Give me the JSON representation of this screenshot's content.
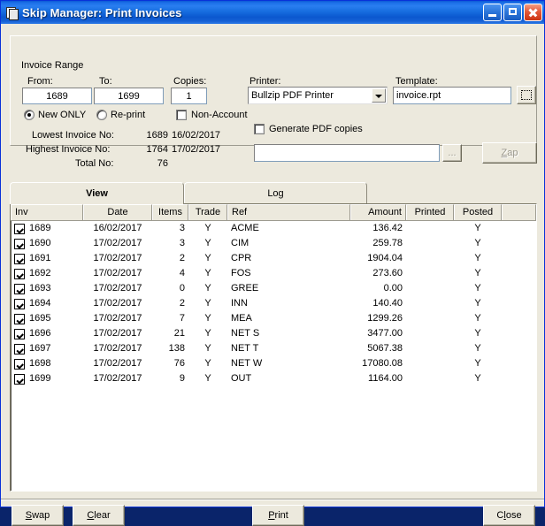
{
  "window": {
    "title": "Skip Manager: Print Invoices",
    "icon": "invoices-icon",
    "minimize_label": "Minimize",
    "maximize_label": "Maximize",
    "close_label": "Close"
  },
  "invoice_range": {
    "legend": "Invoice Range",
    "from_label": "From:",
    "from_value": "1689",
    "to_label": "To:",
    "to_value": "1699",
    "copies_label": "Copies:",
    "copies_value": "1",
    "new_only_label": "New ONLY",
    "new_only_checked": true,
    "reprint_label": "Re-print",
    "reprint_checked": false,
    "non_account_label": "Non-Account",
    "non_account_checked": false,
    "lowest_label": "Lowest Invoice No:",
    "lowest_no": "1689",
    "lowest_date": "16/02/2017",
    "highest_label": "Highest Invoice No:",
    "highest_no": "1764",
    "highest_date": "17/02/2017",
    "total_label": "Total No:",
    "total_value": "76"
  },
  "printer": {
    "printer_label": "Printer:",
    "printer_value": "Bullzip PDF Printer",
    "template_label": "Template:",
    "template_value": "invoice.rpt",
    "template_browse": "…",
    "generate_pdf_label": "Generate PDF copies",
    "generate_pdf_checked": false,
    "pdf_path_value": "",
    "pdf_browse_label": "...",
    "zap_label": "Zap",
    "zap_disabled": true
  },
  "tabs": [
    {
      "label": "View",
      "active": true
    },
    {
      "label": "Log",
      "active": false
    }
  ],
  "table": {
    "columns": [
      "Inv",
      "Date",
      "Items",
      "Trade",
      "Ref",
      "Amount",
      "Printed",
      "Posted",
      ""
    ],
    "rows": [
      {
        "checked": true,
        "inv": "1689",
        "date": "16/02/2017",
        "items": "3",
        "trade": "Y",
        "ref": "ACME",
        "amount": "136.42",
        "printed": "",
        "posted": "Y"
      },
      {
        "checked": true,
        "inv": "1690",
        "date": "17/02/2017",
        "items": "3",
        "trade": "Y",
        "ref": "CIM",
        "amount": "259.78",
        "printed": "",
        "posted": "Y"
      },
      {
        "checked": true,
        "inv": "1691",
        "date": "17/02/2017",
        "items": "2",
        "trade": "Y",
        "ref": "CPR",
        "amount": "1904.04",
        "printed": "",
        "posted": "Y"
      },
      {
        "checked": true,
        "inv": "1692",
        "date": "17/02/2017",
        "items": "4",
        "trade": "Y",
        "ref": "FOS",
        "amount": "273.60",
        "printed": "",
        "posted": "Y"
      },
      {
        "checked": true,
        "inv": "1693",
        "date": "17/02/2017",
        "items": "0",
        "trade": "Y",
        "ref": "GREE",
        "amount": "0.00",
        "printed": "",
        "posted": "Y"
      },
      {
        "checked": true,
        "inv": "1694",
        "date": "17/02/2017",
        "items": "2",
        "trade": "Y",
        "ref": "INN",
        "amount": "140.40",
        "printed": "",
        "posted": "Y"
      },
      {
        "checked": true,
        "inv": "1695",
        "date": "17/02/2017",
        "items": "7",
        "trade": "Y",
        "ref": "MEA",
        "amount": "1299.26",
        "printed": "",
        "posted": "Y"
      },
      {
        "checked": true,
        "inv": "1696",
        "date": "17/02/2017",
        "items": "21",
        "trade": "Y",
        "ref": "NET S",
        "amount": "3477.00",
        "printed": "",
        "posted": "Y"
      },
      {
        "checked": true,
        "inv": "1697",
        "date": "17/02/2017",
        "items": "138",
        "trade": "Y",
        "ref": "NET T",
        "amount": "5067.38",
        "printed": "",
        "posted": "Y"
      },
      {
        "checked": true,
        "inv": "1698",
        "date": "17/02/2017",
        "items": "76",
        "trade": "Y",
        "ref": "NET W",
        "amount": "17080.08",
        "printed": "",
        "posted": "Y"
      },
      {
        "checked": true,
        "inv": "1699",
        "date": "17/02/2017",
        "items": "9",
        "trade": "Y",
        "ref": "OUT",
        "amount": "1164.00",
        "printed": "",
        "posted": "Y"
      }
    ]
  },
  "footer": {
    "swap_label": "Swap",
    "swap_accel": "S",
    "clear_label": "Clear",
    "clear_accel": "C",
    "print_label": "Print",
    "print_accel": "P",
    "close_label": "Close",
    "close_accel": "l"
  },
  "colors": {
    "titlebar": "#0b58cf",
    "face": "#ECE9DD",
    "close_button": "#cc3311",
    "field_bg": "#ffffff"
  }
}
